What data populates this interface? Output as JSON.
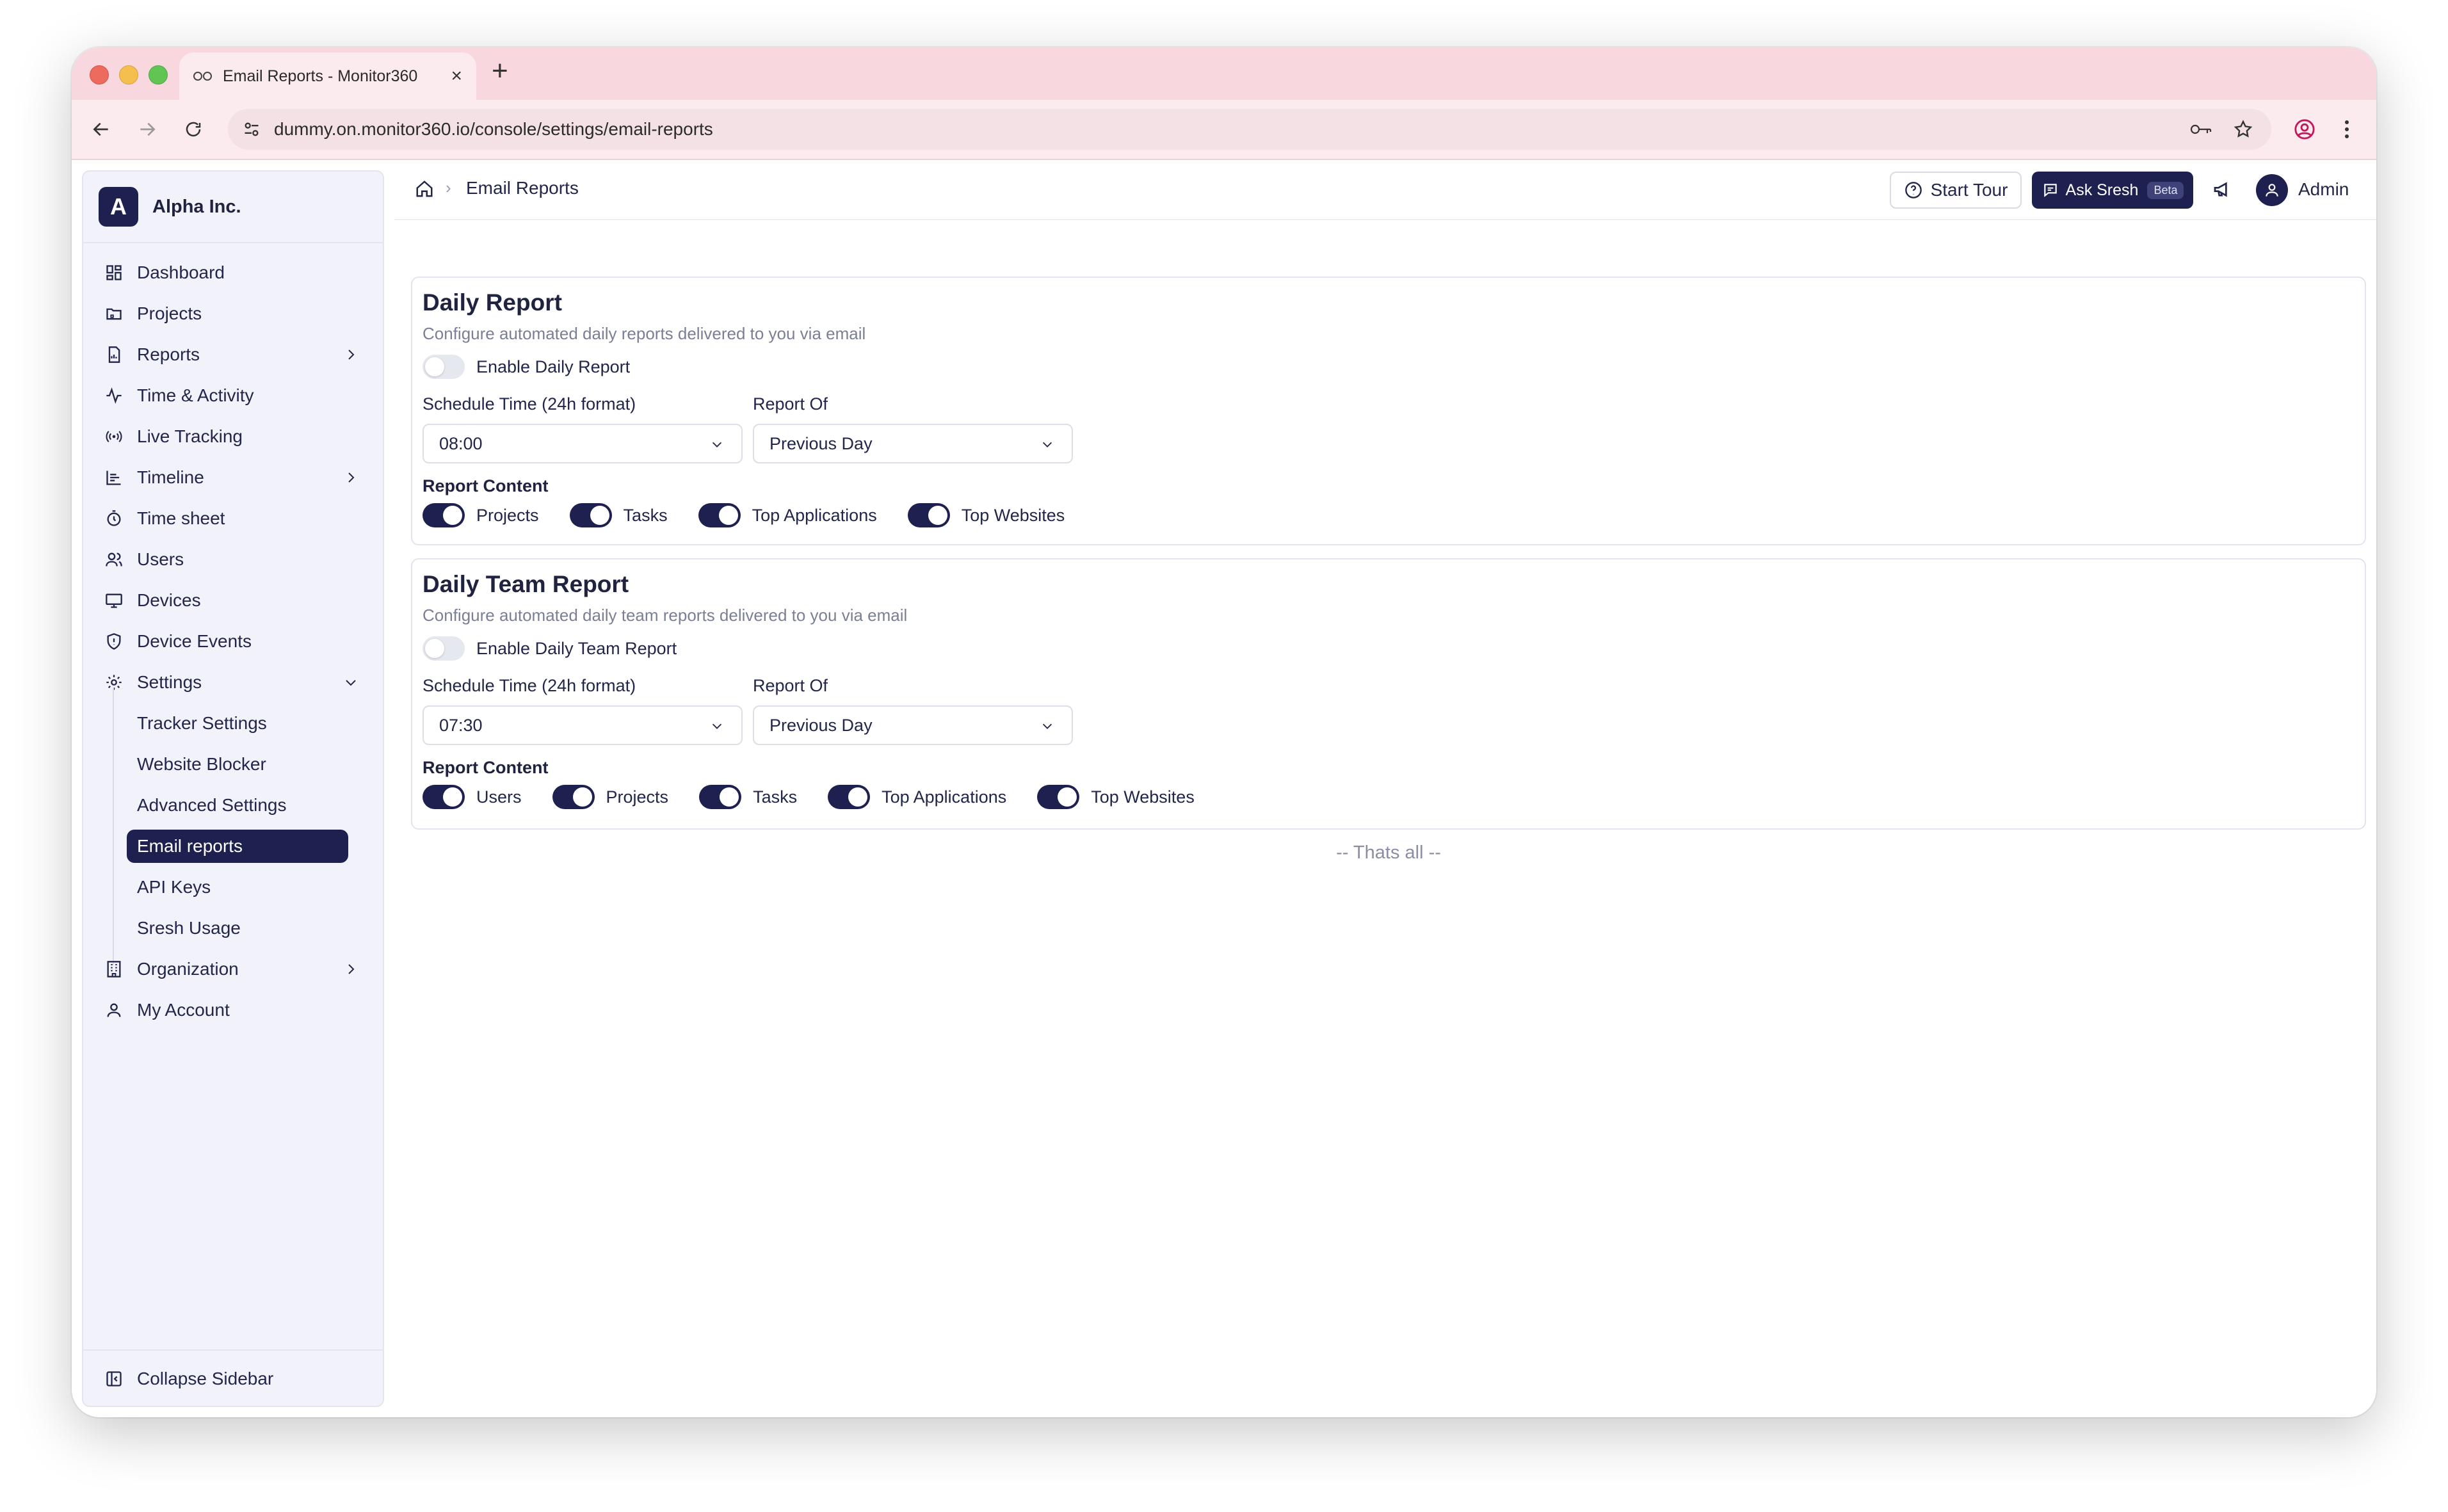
{
  "browser": {
    "tab_title": "Email Reports - Monitor360",
    "url": "dummy.on.monitor360.io/console/settings/email-reports"
  },
  "sidebar": {
    "org_initial": "A",
    "org_name": "Alpha Inc.",
    "items": [
      {
        "label": "Dashboard",
        "icon": "grid-icon"
      },
      {
        "label": "Projects",
        "icon": "folder-icon"
      },
      {
        "label": "Reports",
        "icon": "report-icon"
      },
      {
        "label": "Time & Activity",
        "icon": "activity-icon"
      },
      {
        "label": "Live Tracking",
        "icon": "broadcast-icon"
      },
      {
        "label": "Timeline",
        "icon": "timeline-icon"
      },
      {
        "label": "Time sheet",
        "icon": "timer-icon"
      },
      {
        "label": "Users",
        "icon": "users-icon"
      },
      {
        "label": "Devices",
        "icon": "monitor-icon"
      },
      {
        "label": "Device Events",
        "icon": "shield-icon"
      },
      {
        "label": "Settings",
        "icon": "gear-icon"
      },
      {
        "label": "Organization",
        "icon": "building-icon"
      },
      {
        "label": "My Account",
        "icon": "user-icon"
      }
    ],
    "settings_sub": [
      {
        "label": "Tracker Settings"
      },
      {
        "label": "Website Blocker"
      },
      {
        "label": "Advanced Settings"
      },
      {
        "label": "Email reports",
        "active": true
      },
      {
        "label": "API Keys"
      },
      {
        "label": "Sresh Usage"
      }
    ],
    "collapse_label": "Collapse Sidebar"
  },
  "header": {
    "breadcrumb": "Email Reports",
    "start_tour": "Start Tour",
    "ask": "Ask Sresh",
    "beta": "Beta",
    "user": "Admin"
  },
  "daily": {
    "title": "Daily Report",
    "desc": "Configure automated daily reports delivered to you via email",
    "enable_label": "Enable Daily Report",
    "enabled": false,
    "schedule_label": "Schedule Time (24h format)",
    "schedule_value": "08:00",
    "report_of_label": "Report Of",
    "report_of_value": "Previous Day",
    "content_label": "Report Content",
    "content": [
      {
        "label": "Projects",
        "on": true
      },
      {
        "label": "Tasks",
        "on": true
      },
      {
        "label": "Top Applications",
        "on": true
      },
      {
        "label": "Top Websites",
        "on": true
      }
    ]
  },
  "team": {
    "title": "Daily Team Report",
    "desc": "Configure automated daily team reports delivered to you via email",
    "enable_label": "Enable Daily Team Report",
    "enabled": false,
    "schedule_label": "Schedule Time (24h format)",
    "schedule_value": "07:30",
    "report_of_label": "Report Of",
    "report_of_value": "Previous Day",
    "content_label": "Report Content",
    "content": [
      {
        "label": "Users",
        "on": true
      },
      {
        "label": "Projects",
        "on": true
      },
      {
        "label": "Tasks",
        "on": true
      },
      {
        "label": "Top Applications",
        "on": true
      },
      {
        "label": "Top Websites",
        "on": true
      }
    ]
  },
  "footer_note": "-- Thats all --",
  "colors": {
    "brand": "#1e2150",
    "tabstrip": "#f8d7de",
    "sidebar_bg": "#f2f3fa"
  }
}
